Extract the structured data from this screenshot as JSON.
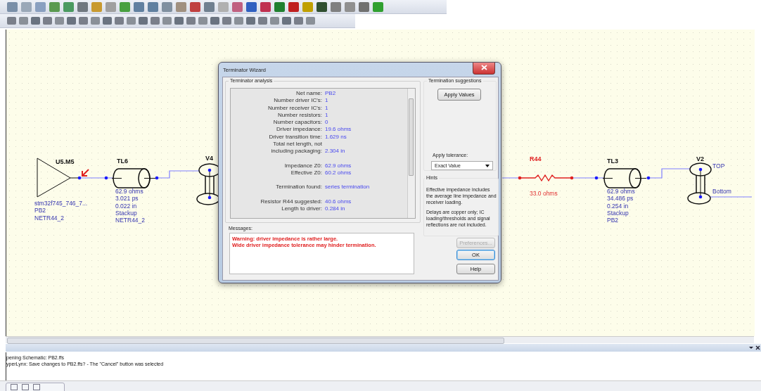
{
  "schematic": {
    "components": [
      {
        "kind": "driver",
        "ref": "U5.M5",
        "lines": [
          "stm32f745_746_7...",
          "PB2",
          "NETR44_2"
        ]
      },
      {
        "kind": "tline",
        "ref": "TL6",
        "lines": [
          "62.9 ohms",
          "3.021 ps",
          "0.022 in",
          "Stackup",
          "NETR44_2"
        ]
      },
      {
        "kind": "via",
        "ref": "V4"
      },
      {
        "kind": "resistor",
        "ref": "R44",
        "lines": [
          "33.0 ohms"
        ]
      },
      {
        "kind": "tline",
        "ref": "TL3",
        "lines": [
          "62.9 ohms",
          "34.486 ps",
          "0.254 in",
          "Stackup",
          "PB2"
        ]
      },
      {
        "kind": "via",
        "ref": "V2",
        "top_label": "TOP",
        "bottom_label": "Bottom"
      }
    ]
  },
  "dialog": {
    "title": "Terminator Wizard",
    "analysis": {
      "title": "Terminator analysis",
      "sections": [
        [
          {
            "label": "Net name:",
            "value": "PB2"
          },
          {
            "label": "Number driver IC's:",
            "value": "1"
          },
          {
            "label": "Number receiver IC's:",
            "value": "1"
          },
          {
            "label": "Number resistors:",
            "value": "1"
          },
          {
            "label": "Number capacitors:",
            "value": "0"
          },
          {
            "label": "Driver impedance:",
            "value": "19.6 ohms"
          },
          {
            "label": "Driver transition time:",
            "value": "1.629 ns"
          },
          {
            "label": "Total net length, not"
          },
          {
            "label": "including packaging:",
            "value": "2.304 in"
          }
        ],
        [
          {
            "label": "Impedance Z0:",
            "value": "62.9 ohms"
          },
          {
            "label": "Effective Z0:",
            "value": "60.2 ohms"
          }
        ],
        [
          {
            "label": "Termination found:",
            "value": "series termination"
          }
        ],
        [
          {
            "label": "Resistor R44 suggested:",
            "value": "40.6 ohms"
          },
          {
            "label": "Length to driver:",
            "value": "0.284 in"
          }
        ]
      ]
    },
    "messages": {
      "title": "Messages:",
      "lines": [
        "Warning: driver impedance is rather large.",
        "Wide driver impedance tolerance may hinder termination."
      ]
    },
    "suggestions": {
      "title": "Termination suggestions",
      "apply_button": "Apply Values"
    },
    "tolerance": {
      "label": "Apply tolerance:",
      "value": "Exact Value"
    },
    "hints": {
      "title": "Hints",
      "paragraphs": [
        "Effective impedance includes the average line impedance and receiver loading.",
        "Delays are copper only; IC loading/thresholds and signal reflections are not  included."
      ]
    },
    "buttons": [
      {
        "label": "Preferences...",
        "disabled": true,
        "default": false
      },
      {
        "label": "OK",
        "disabled": false,
        "default": true
      },
      {
        "label": "Help",
        "disabled": false,
        "default": false
      }
    ]
  },
  "output": {
    "lines": [
      "pening Schematic: PB2.ffs",
      "yperLynx: Save changes to PB2.ffs? - The \"Cancel\" button was selected"
    ]
  }
}
